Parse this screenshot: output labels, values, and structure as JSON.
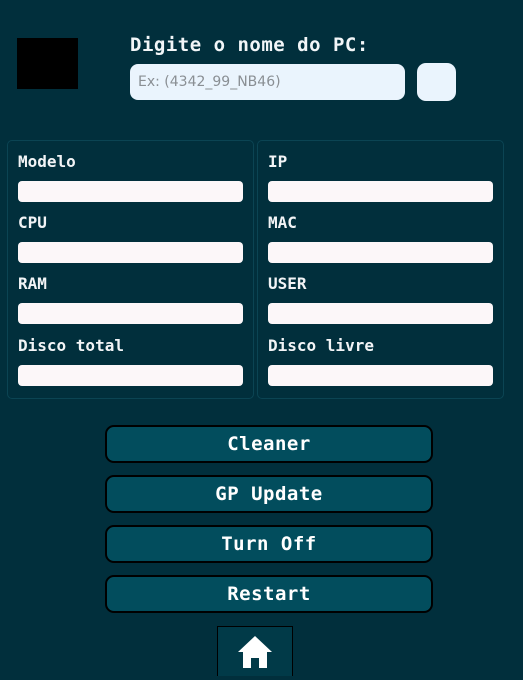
{
  "header": {
    "prompt": "Digite o nome do PC:",
    "search_placeholder": "Ex: (4342_99_NB46)",
    "search_value": ""
  },
  "info_left": [
    {
      "label": "Modelo",
      "value": ""
    },
    {
      "label": "CPU",
      "value": ""
    },
    {
      "label": "RAM",
      "value": ""
    },
    {
      "label": "Disco total",
      "value": ""
    }
  ],
  "info_right": [
    {
      "label": "IP",
      "value": ""
    },
    {
      "label": "MAC",
      "value": ""
    },
    {
      "label": "USER",
      "value": ""
    },
    {
      "label": "Disco livre",
      "value": ""
    }
  ],
  "actions": {
    "cleaner": "Cleaner",
    "gp_update": "GP Update",
    "turn_off": "Turn Off",
    "restart": "Restart"
  },
  "icons": {
    "home": "home-icon",
    "logo": "logo"
  },
  "colors": {
    "background": "#012f3c",
    "button": "#024d5d",
    "field": "#fcf7f9",
    "input": "#eaf4fd"
  }
}
